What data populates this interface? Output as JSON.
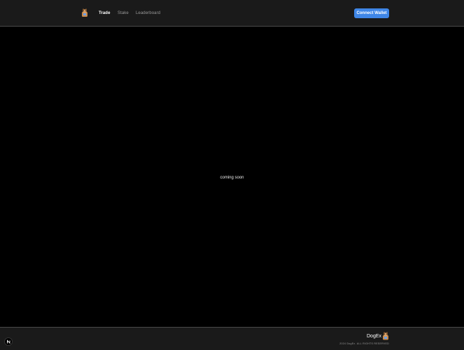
{
  "header": {
    "logo_icon": "dog-avatar-icon",
    "nav": [
      {
        "label": "Trade",
        "active": true
      },
      {
        "label": "Stake",
        "active": false
      },
      {
        "label": "Leaderboard",
        "active": false
      }
    ],
    "connect_label": "Connect Wallet"
  },
  "main": {
    "message": "coming soon"
  },
  "footer": {
    "brand": "DogEx",
    "logo_icon": "dog-avatar-icon",
    "copyright": "2024 DogEx. ALL RIGHTS RESERVED"
  },
  "corner_button": {
    "icon": "nextjs-icon"
  },
  "colors": {
    "background": "#000000",
    "header_bg": "#1a1a1a",
    "accent": "#3f86e6",
    "muted_text": "#9a9a9a"
  }
}
